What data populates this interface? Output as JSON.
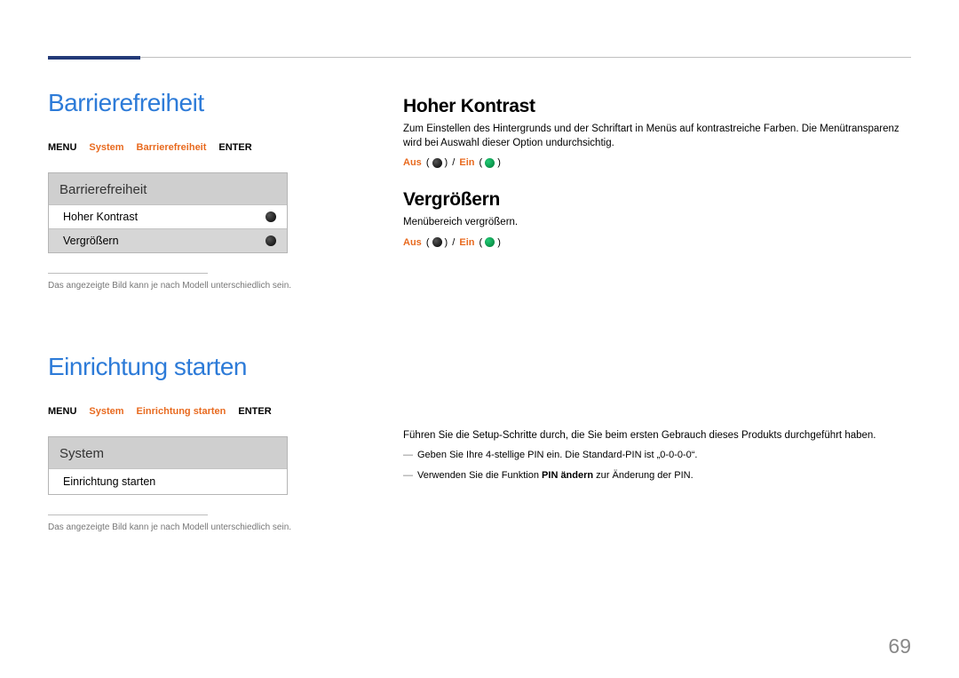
{
  "page_number": "69",
  "left": {
    "section1": {
      "title": "Barrierefreiheit",
      "breadcrumb": {
        "menu": "MENU",
        "system": "System",
        "item": "Barrierefreiheit",
        "enter": "ENTER"
      },
      "screenshot": {
        "header": "Barrierefreiheit",
        "row1": "Hoher Kontrast",
        "row2": "Vergrößern"
      },
      "note": "Das angezeigte Bild kann je nach Modell unterschiedlich sein."
    },
    "section2": {
      "title": "Einrichtung starten",
      "breadcrumb": {
        "menu": "MENU",
        "system": "System",
        "item": "Einrichtung starten",
        "enter": "ENTER"
      },
      "screenshot": {
        "header": "System",
        "row1": "Einrichtung starten"
      },
      "note": "Das angezeigte Bild kann je nach Modell unterschiedlich sein."
    }
  },
  "right": {
    "high_contrast": {
      "title": "Hoher Kontrast",
      "desc": "Zum Einstellen des Hintergrunds und der Schriftart in Menüs auf kontrastreiche Farben. Die Menütransparenz wird bei Auswahl dieser Option undurchsichtig.",
      "off": "Aus",
      "on": "Ein"
    },
    "enlarge": {
      "title": "Vergrößern",
      "desc": "Menübereich vergrößern.",
      "off": "Aus",
      "on": "Ein"
    },
    "setup": {
      "desc": "Führen Sie die Setup-Schritte durch, die Sie beim ersten Gebrauch dieses Produkts durchgeführt haben.",
      "sub1": "Geben Sie Ihre 4-stellige PIN ein. Die Standard-PIN ist „0-0-0-0“.",
      "sub2_pre": "Verwenden Sie die Funktion ",
      "sub2_bold": "PIN ändern",
      "sub2_post": " zur Änderung der PIN."
    }
  }
}
